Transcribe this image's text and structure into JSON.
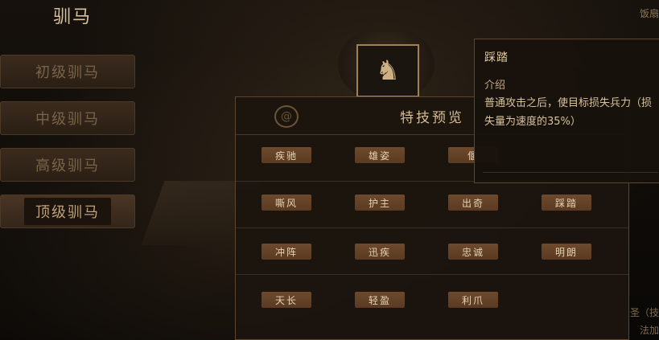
{
  "header": {
    "title": "驯马",
    "top_right": "饭扇"
  },
  "sidebar": {
    "items": [
      {
        "label": "初级驯马"
      },
      {
        "label": "中级驯马"
      },
      {
        "label": "高级驯马"
      },
      {
        "label": "顶级驯马"
      }
    ]
  },
  "emblem": {
    "icon": "horse-icon",
    "glyph": "♞"
  },
  "panel": {
    "title": "特技预览",
    "rows": [
      [
        "疾驰",
        "雄姿",
        "偃",
        ""
      ],
      [
        "嘶风",
        "护主",
        "出奇",
        "踩踏"
      ],
      [
        "冲阵",
        "迅疾",
        "忠诚",
        "明朗"
      ],
      [
        "天长",
        "轻盈",
        "利爪",
        ""
      ]
    ]
  },
  "tooltip": {
    "name": "踩踏",
    "label": "介绍",
    "description": "普通攻击之后，使目标损失兵力（损失量为速度的35%）"
  },
  "right_edge": {
    "line1": "圣（技",
    "line2": "法加"
  }
}
